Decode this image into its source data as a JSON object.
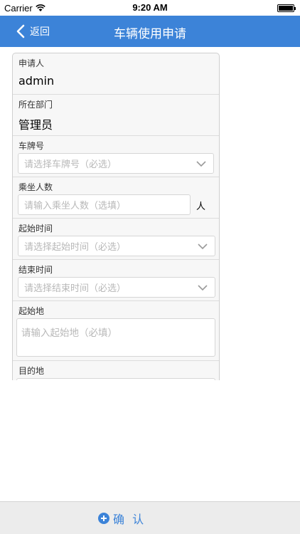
{
  "status_bar": {
    "carrier": "Carrier",
    "time": "9:20 AM"
  },
  "nav": {
    "back_label": "返回",
    "title": "车辆使用申请"
  },
  "form": {
    "applicant": {
      "label": "申请人",
      "value": "admin"
    },
    "department": {
      "label": "所在部门",
      "value": "管理员"
    },
    "plate": {
      "label": "车牌号",
      "placeholder": "请选择车牌号（必选）"
    },
    "passengers": {
      "label": "乘坐人数",
      "placeholder": "请输入乘坐人数（选填）",
      "unit": "人"
    },
    "start_time": {
      "label": "起始时间",
      "placeholder": "请选择起始时间（必选）"
    },
    "end_time": {
      "label": "结束时间",
      "placeholder": "请选择结束时间（必选）"
    },
    "origin": {
      "label": "起始地",
      "placeholder": "请输入起始地（必填）"
    },
    "destination": {
      "label": "目的地"
    }
  },
  "bottom": {
    "confirm_label": "确 认"
  },
  "colors": {
    "accent": "#3c83d8",
    "card_bg": "#f7f7f7"
  }
}
